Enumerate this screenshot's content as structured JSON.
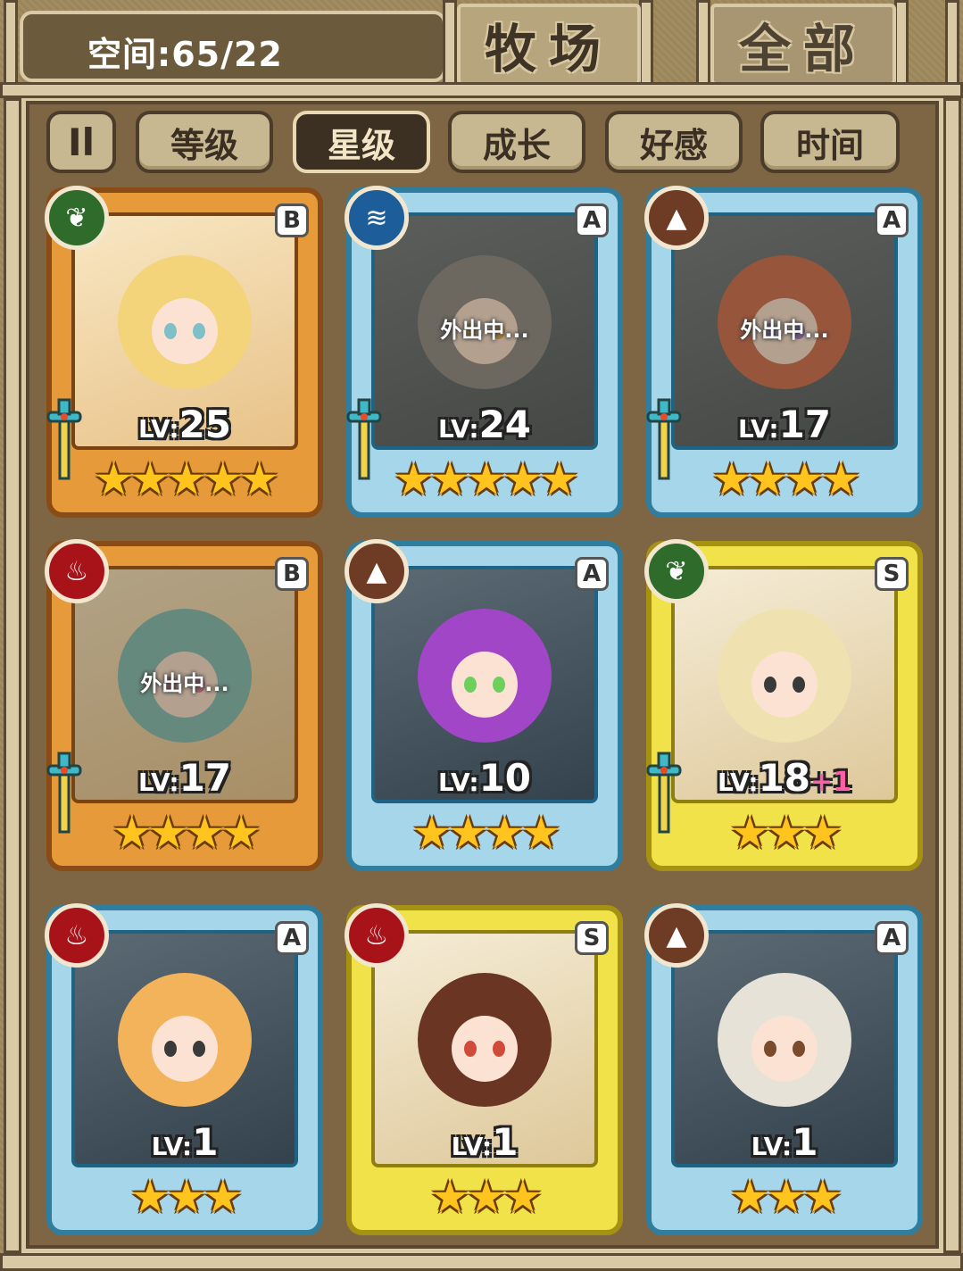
{
  "header": {
    "space_label": "空间:65/22",
    "tabs": [
      {
        "label": "牧场",
        "active": true
      },
      {
        "label": "全部",
        "active": false
      }
    ]
  },
  "sort": {
    "toggle_label": "Il",
    "buttons": [
      {
        "label": "等级",
        "active": false
      },
      {
        "label": "星级",
        "active": true
      },
      {
        "label": "成长",
        "active": false
      },
      {
        "label": "好感",
        "active": false
      },
      {
        "label": "时间",
        "active": false
      }
    ]
  },
  "cards": [
    {
      "element": "leaf",
      "rank": "B",
      "frame": "gold",
      "level": "25",
      "stars": 5,
      "away": false,
      "plus": "",
      "weapon": true
    },
    {
      "element": "water",
      "rank": "A",
      "frame": "blue",
      "level": "24",
      "stars": 5,
      "away": true,
      "plus": "",
      "weapon": true
    },
    {
      "element": "earth",
      "rank": "A",
      "frame": "blue",
      "level": "17",
      "stars": 4,
      "away": true,
      "plus": "",
      "weapon": true
    },
    {
      "element": "fire",
      "rank": "B",
      "frame": "gold",
      "level": "17",
      "stars": 4,
      "away": true,
      "plus": "",
      "weapon": true
    },
    {
      "element": "earth",
      "rank": "A",
      "frame": "blue",
      "level": "10",
      "stars": 4,
      "away": false,
      "plus": "",
      "weapon": false
    },
    {
      "element": "leaf",
      "rank": "S",
      "frame": "yellow",
      "level": "18",
      "stars": 3,
      "away": false,
      "plus": "+1",
      "weapon": true
    },
    {
      "element": "fire",
      "rank": "A",
      "frame": "blue",
      "level": "1",
      "stars": 3,
      "away": false,
      "plus": "",
      "weapon": false
    },
    {
      "element": "fire",
      "rank": "S",
      "frame": "yellow",
      "level": "1",
      "stars": 3,
      "away": false,
      "plus": "",
      "weapon": false
    },
    {
      "element": "earth",
      "rank": "A",
      "frame": "blue",
      "level": "1",
      "stars": 3,
      "away": false,
      "plus": "",
      "weapon": false
    }
  ],
  "text": {
    "away_label": "外出中...",
    "level_prefix": "LV:"
  },
  "colors": {
    "panel": "#7e6644",
    "trim": "#d9c9a4",
    "star": "#ffc51e",
    "plus": "#ff5fa8"
  }
}
